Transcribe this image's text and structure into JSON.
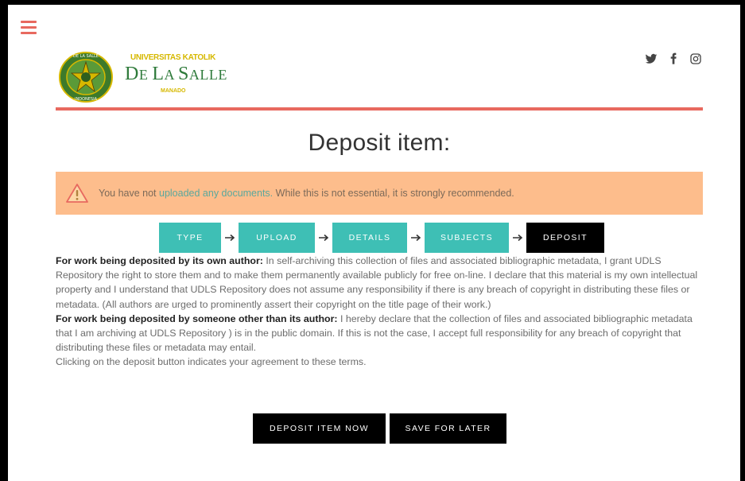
{
  "header": {
    "menu_icon": "hamburger-menu-icon",
    "logo": {
      "university": "UNIVERSITAS KATOLIK",
      "name_prefix": "D",
      "name_small_1": "E ",
      "name_mid": "L",
      "name_small_2": "A ",
      "name_cap": "S",
      "name_small_3": "ALLE",
      "city": "MANADO",
      "seal_text_top": "DE LA SALLE",
      "seal_text_bottom": "INDONESIA"
    },
    "social": [
      "twitter-icon",
      "facebook-icon",
      "instagram-icon"
    ],
    "accent_color": "#e8695f"
  },
  "page": {
    "title": "Deposit item:"
  },
  "warning": {
    "before": "You have not ",
    "link": "uploaded any documents.",
    "after": " While this is not essential, it is strongly recommended.",
    "background": "#fdbd8c",
    "icon": "warning-triangle-icon"
  },
  "steps": [
    {
      "label": "TYPE",
      "active": false
    },
    {
      "label": "UPLOAD",
      "active": false
    },
    {
      "label": "DETAILS",
      "active": false
    },
    {
      "label": "SUBJECTS",
      "active": false
    },
    {
      "label": "DEPOSIT",
      "active": true
    }
  ],
  "step_color": "#3ebfb5",
  "terms": {
    "own_author_heading": "For work being deposited by its own author:",
    "own_author_text": " In self-archiving this collection of files and associated bibliographic metadata, I grant UDLS Repository the right to store them and to make them permanently available publicly for free on-line. I declare that this material is my own intellectual property and I understand that UDLS Repository does not assume any responsibility if there is any breach of copyright in distributing these files or metadata. (All authors are urged to prominently assert their copyright on the title page of their work.)",
    "other_author_heading": "For work being deposited by someone other than its author:",
    "other_author_text": " I hereby declare that the collection of files and associated bibliographic metadata that I am archiving at UDLS Repository ) is in the public domain. If this is not the case, I accept full responsibility for any breach of copyright that distributing these files or metadata may entail.",
    "agreement": "Clicking on the deposit button indicates your agreement to these terms."
  },
  "actions": {
    "deposit_now": "DEPOSIT ITEM NOW",
    "save_later": "SAVE FOR LATER"
  }
}
